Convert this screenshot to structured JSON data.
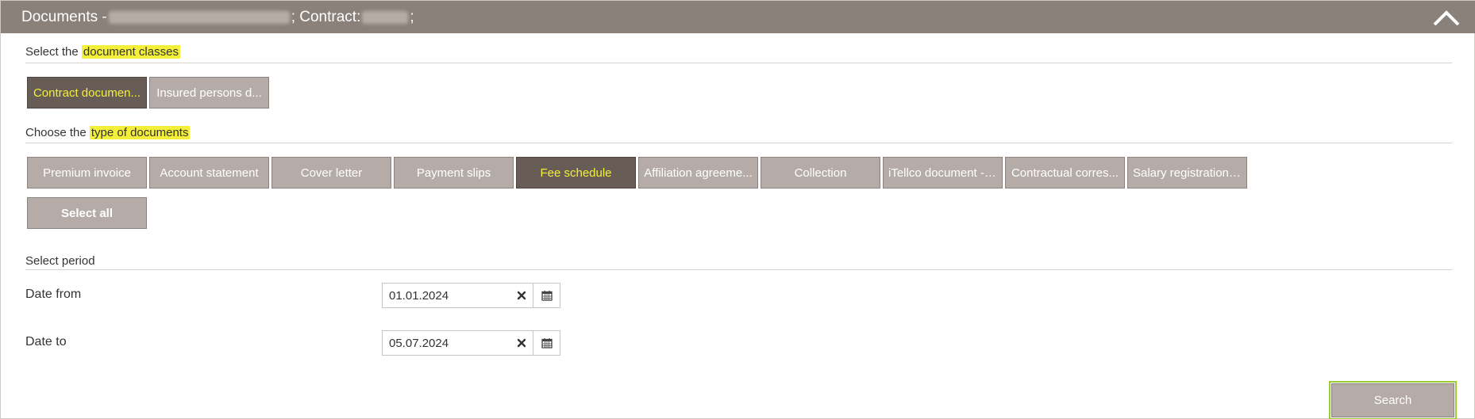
{
  "header": {
    "title_prefix": "Documents - ",
    "contract_label": "; Contract: ",
    "suffix": ";"
  },
  "classes": {
    "label_before": "Select the ",
    "label_highlight": "document classes",
    "buttons": [
      {
        "label": "Contract documen...",
        "active": true
      },
      {
        "label": "Insured persons d...",
        "active": false
      }
    ]
  },
  "types": {
    "label_before": "Choose the ",
    "label_highlight": "type of documents",
    "buttons": [
      {
        "label": "Premium invoice",
        "active": false
      },
      {
        "label": "Account statement",
        "active": false
      },
      {
        "label": "Cover letter",
        "active": false
      },
      {
        "label": "Payment slips",
        "active": false
      },
      {
        "label": "Fee schedule",
        "active": true
      },
      {
        "label": "Affiliation agreeme...",
        "active": false
      },
      {
        "label": "Collection",
        "active": false
      },
      {
        "label": "iTellco document - ...",
        "active": false
      },
      {
        "label": "Contractual corres...",
        "active": false
      },
      {
        "label": "Salary registration ...",
        "active": false
      }
    ],
    "select_all": "Select all"
  },
  "period": {
    "label": "Select period",
    "date_from_label": "Date from",
    "date_from_value": "01.01.2024",
    "date_to_label": "Date to",
    "date_to_value": "05.07.2024"
  },
  "search_label": "Search",
  "colors": {
    "header": "#8b817b",
    "button": "#b5aca8",
    "button_active": "#675c56",
    "highlight": "#f4f03a",
    "search_outline": "#9acd32"
  },
  "icons": {
    "collapse": "chevron-up-icon",
    "clear": "close-icon",
    "calendar": "calendar-icon"
  }
}
